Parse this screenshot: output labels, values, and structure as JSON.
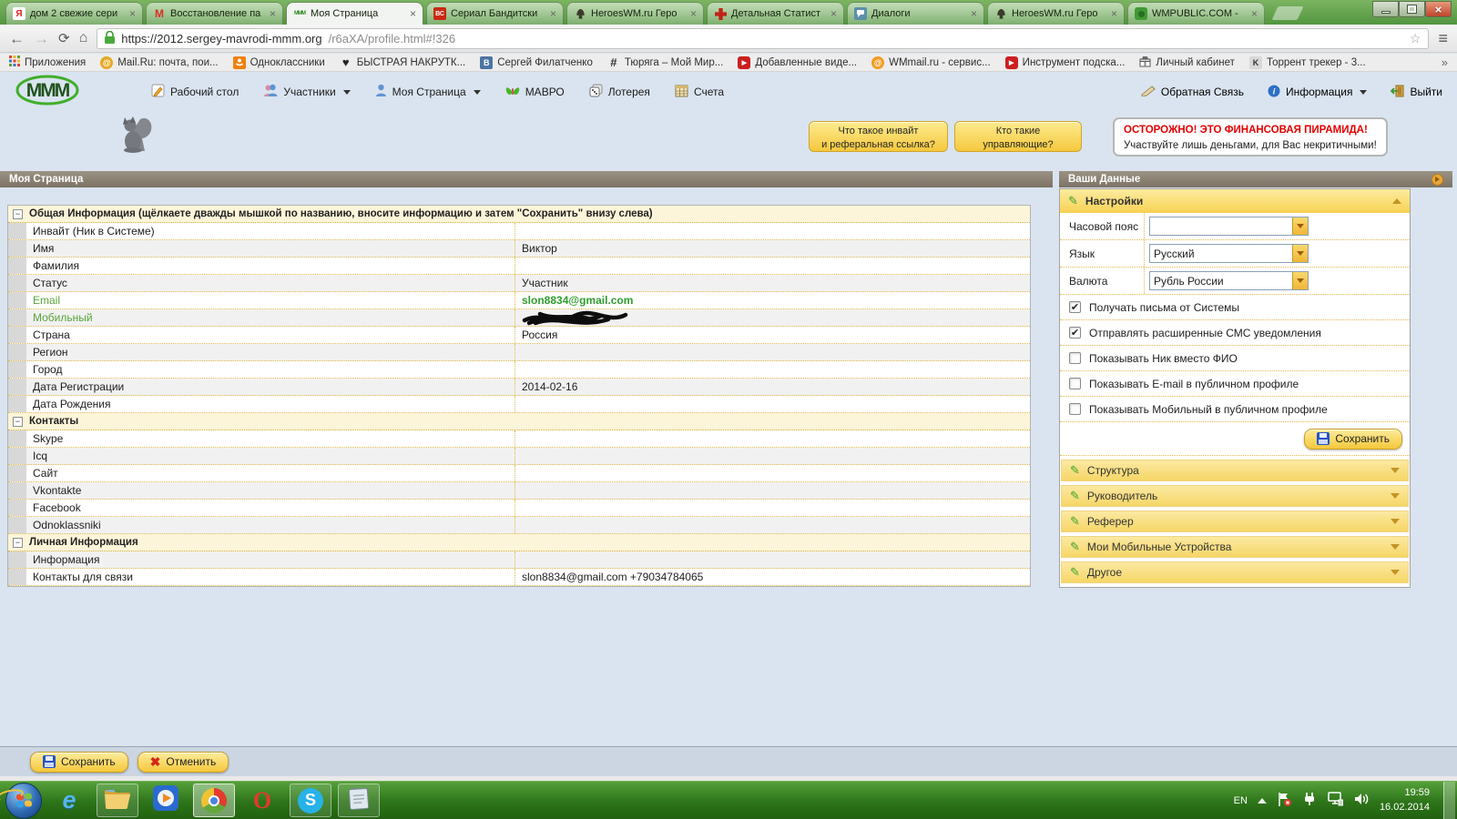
{
  "icons": {
    "close": "×",
    "star": "☆",
    "menu": "≡",
    "back": "←",
    "forward": "→",
    "reload": "⟳",
    "home": "⌂",
    "overflow": "»",
    "minus": "−",
    "check": "✔",
    "heart": "♥",
    "at": "@",
    "play": "▶",
    "pencil": "✎",
    "info_glyph": "i",
    "hash": "#",
    "cancel": "✖",
    "ie": "e",
    "opera": "O",
    "skype": "S",
    "k": "K",
    "envelope": "✉"
  },
  "browser": {
    "tabs": [
      {
        "icon_text": "Я",
        "label": "дом 2 свежие сери"
      },
      {
        "icon_text": "M",
        "label": "Восстановление па"
      },
      {
        "icon_text": "MMM",
        "label": "Моя Страница",
        "active": true
      },
      {
        "icon_text": "ВС",
        "label": "Сериал Бандитски"
      },
      {
        "icon_text": "",
        "label": "HeroesWM.ru Геро"
      },
      {
        "icon_text": "",
        "label": "Детальная Статист"
      },
      {
        "icon_text": "",
        "label": "Диалоги"
      },
      {
        "icon_text": "",
        "label": "HeroesWM.ru Геро"
      },
      {
        "icon_text": "",
        "label": "WMPUBLIC.COM -"
      }
    ],
    "url_host": "https://2012.sergey-mavrodi-mmm.org",
    "url_path": "/r6aXA/profile.html#!326",
    "bookmarks": [
      {
        "label": "Приложения"
      },
      {
        "label": "Mail.Ru: почта, пои..."
      },
      {
        "label": "Одноклассники"
      },
      {
        "label": "БЫСТРАЯ НАКРУТК..."
      },
      {
        "label": "Сергей Филатченко"
      },
      {
        "label": "Тюряга – Мой Мир..."
      },
      {
        "label": "Добавленные виде..."
      },
      {
        "label": "WMmail.ru - сервис..."
      },
      {
        "label": "Инструмент подска..."
      },
      {
        "label": "Личный кабинет"
      },
      {
        "label": "Торрент трекер - 3..."
      }
    ]
  },
  "site": {
    "logo_text": "MMM",
    "nav": [
      {
        "label": "Рабочий стол"
      },
      {
        "label": "Участники"
      },
      {
        "label": "Моя Страница"
      },
      {
        "label": "МАВРО"
      },
      {
        "label": "Лотерея"
      },
      {
        "label": "Счета"
      }
    ],
    "nav_right": [
      {
        "label": "Обратная Связь"
      },
      {
        "label": "Информация"
      },
      {
        "label": "Выйти"
      }
    ],
    "promo_buttons": [
      {
        "line1": "Что такое инвайт",
        "line2": "и реферальная ссылка?"
      },
      {
        "line1": "Кто такие",
        "line2": "управляющие?"
      }
    ],
    "warning": {
      "line1": "ОСТОРОЖНО! ЭТО ФИНАНСОВАЯ ПИРАМИДА!",
      "line2": "Участвуйте лишь деньгами, для Вас некритичными!"
    }
  },
  "profile": {
    "panel_title": "Моя Страница",
    "items": [
      {
        "type": "section",
        "label": "Общая Информация (щёлкаете дважды мышкой по названию, вносите информацию и затем \"Сохранить\" внизу слева)"
      },
      {
        "type": "row",
        "label": "Инвайт (Ник в Системе)",
        "value": ""
      },
      {
        "type": "row",
        "label": "Имя",
        "value": "Виктор"
      },
      {
        "type": "row",
        "label": "Фамилия",
        "value": ""
      },
      {
        "type": "row",
        "label": "Статус",
        "value": "Участник"
      },
      {
        "type": "row",
        "label": "Email",
        "value": "slon8834@gmail.com",
        "green": true
      },
      {
        "type": "row",
        "label": "Мобильный",
        "value": "",
        "green": true,
        "redacted": true
      },
      {
        "type": "row",
        "label": "Страна",
        "value": "Россия"
      },
      {
        "type": "row",
        "label": "Регион",
        "value": ""
      },
      {
        "type": "row",
        "label": "Город",
        "value": ""
      },
      {
        "type": "row",
        "label": "Дата Регистрации",
        "value": "2014-02-16"
      },
      {
        "type": "row",
        "label": "Дата Рождения",
        "value": ""
      },
      {
        "type": "section",
        "label": "Контакты"
      },
      {
        "type": "row",
        "label": "Skype",
        "value": ""
      },
      {
        "type": "row",
        "label": "Icq",
        "value": ""
      },
      {
        "type": "row",
        "label": "Сайт",
        "value": ""
      },
      {
        "type": "row",
        "label": "Vkontakte",
        "value": ""
      },
      {
        "type": "row",
        "label": "Facebook",
        "value": ""
      },
      {
        "type": "row",
        "label": "Odnoklassniki",
        "value": ""
      },
      {
        "type": "section",
        "label": "Личная Информация"
      },
      {
        "type": "row",
        "label": "Информация",
        "value": ""
      },
      {
        "type": "row",
        "label": "Контакты для связи",
        "value": "slon8834@gmail.com +79034784065"
      }
    ],
    "save_label": "Сохранить",
    "cancel_label": "Отменить"
  },
  "your_data": {
    "panel_title": "Ваши Данные",
    "settings_title": "Настройки",
    "fields": [
      {
        "label": "Часовой пояс",
        "value": ""
      },
      {
        "label": "Язык",
        "value": "Русский"
      },
      {
        "label": "Валюта",
        "value": "Рубль России"
      }
    ],
    "checkboxes": [
      {
        "label": "Получать письма от Системы",
        "checked": true
      },
      {
        "label": "Отправлять расширенные СМС уведомления",
        "checked": true
      },
      {
        "label": "Показывать Ник вместо ФИО",
        "checked": false
      },
      {
        "label": "Показывать E-mail в публичном профиле",
        "checked": false
      },
      {
        "label": "Показывать Мобильный в публичном профиле",
        "checked": false
      }
    ],
    "save_label": "Сохранить",
    "accordions": [
      {
        "label": "Структура"
      },
      {
        "label": "Руководитель"
      },
      {
        "label": "Реферер"
      },
      {
        "label": "Мои Мобильные Устройства"
      },
      {
        "label": "Другое"
      }
    ]
  },
  "taskbar": {
    "lang": "EN",
    "time": "19:59",
    "date": "16.02.2014"
  }
}
